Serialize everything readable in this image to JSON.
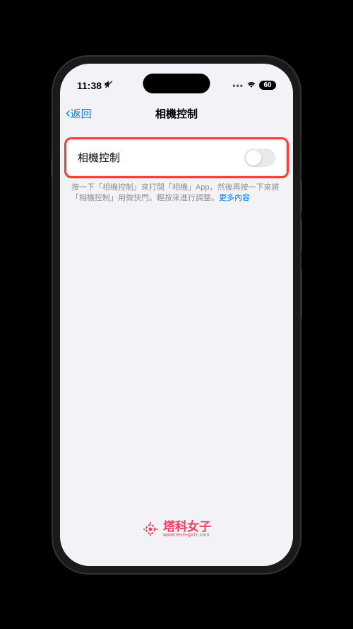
{
  "statusBar": {
    "time": "11:38",
    "batteryLevel": "60"
  },
  "navBar": {
    "backLabel": "返回",
    "title": "相機控制"
  },
  "settings": {
    "cameraControl": {
      "label": "相機控制",
      "enabled": false
    }
  },
  "footer": {
    "text": "按一下「相機控制」來打開「相機」App，然後再按一下來將「相機控制」用做快門。輕按來進行調整。",
    "linkText": "更多內容"
  },
  "watermark": {
    "brand": "塔科女子",
    "url": "www.tech-girlz.com"
  }
}
